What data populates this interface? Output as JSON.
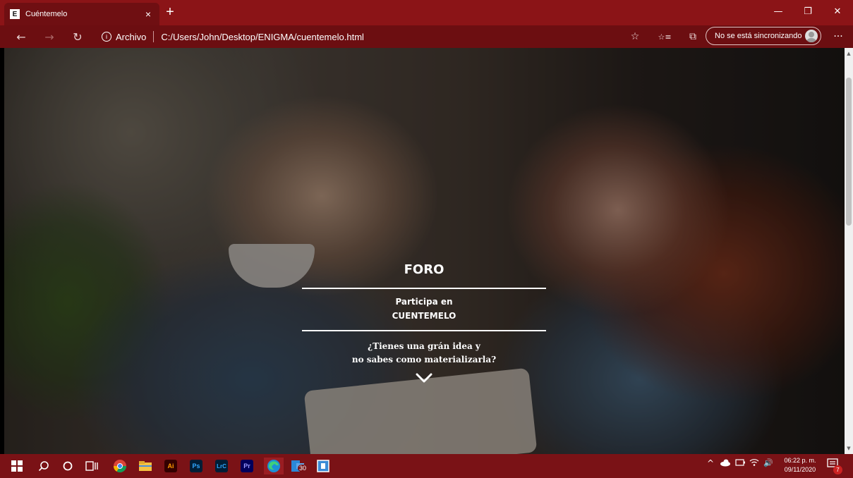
{
  "browser": {
    "tab": {
      "favicon_letter": "E",
      "title": "Cuéntemelo",
      "close": "×"
    },
    "new_tab": "+",
    "window_controls": {
      "minimize": "—",
      "restore": "❐",
      "close": "✕"
    },
    "nav": {
      "back": "←",
      "forward": "→",
      "refresh": "↻"
    },
    "address": {
      "info": "i",
      "scheme_label": "Archivo",
      "url": "C:/Users/John/Desktop/ENIGMA/cuentemelo.html"
    },
    "toolbar": {
      "favorite": "☆",
      "favorites": "☆≡",
      "collections": "⧉",
      "more": "···"
    },
    "sync_label": "No se está sincronizando"
  },
  "hero": {
    "title": "FORO",
    "subtitle_line1": "Participa en",
    "subtitle_line2": "CUENTEMELO",
    "question_line1": "¿Tienes una grán idea y",
    "question_line2": "no sabes como materializarla?"
  },
  "scrollbar": {
    "up": "▲",
    "down": "▼"
  },
  "taskbar": {
    "apps": [
      {
        "name": "Ai",
        "bg": "#330000",
        "fg": "#ff9a00"
      },
      {
        "name": "Ps",
        "bg": "#001e36",
        "fg": "#31a8ff"
      },
      {
        "name": "LrC",
        "bg": "#001e36",
        "fg": "#31a8ff"
      },
      {
        "name": "Pr",
        "bg": "#00005b",
        "fg": "#9999ff"
      }
    ],
    "badge_count": "30",
    "tray_up": "^",
    "tray_volume": "🔊",
    "time": "06:22 p. m.",
    "date": "09/11/2020",
    "notification_count": "7"
  },
  "colors": {
    "accent": "#8b1417",
    "address_bar": "#6c0e11",
    "taskbar": "#7a1216"
  }
}
